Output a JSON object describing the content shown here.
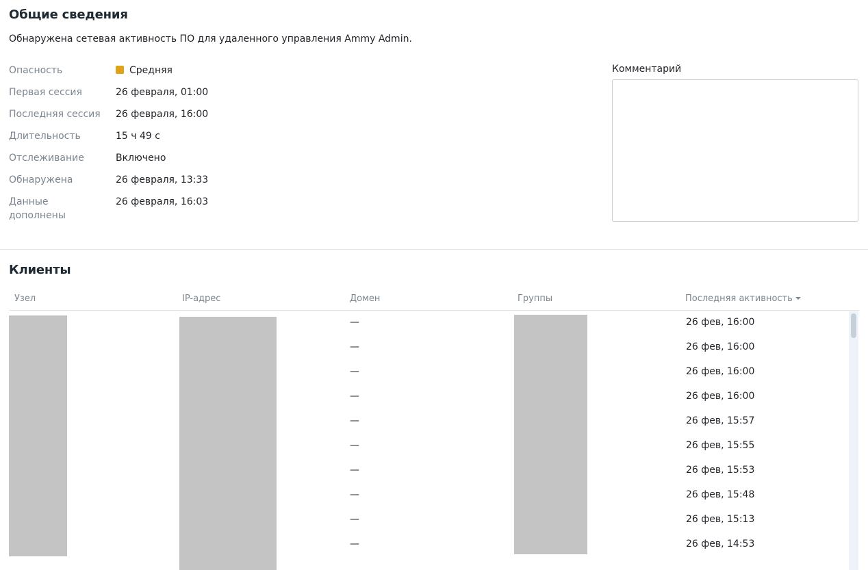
{
  "overview": {
    "title": "Общие сведения",
    "description": "Обнаружена сетевая активность ПО для удаленного управления Ammy Admin.",
    "severity_color": "#e0a21b",
    "properties": [
      {
        "label": "Опасность",
        "value": "Средняя"
      },
      {
        "label": "Первая сессия",
        "value": "26 февраля, 01:00"
      },
      {
        "label": "Последняя сессия",
        "value": "26 февраля, 16:00"
      },
      {
        "label": "Длительность",
        "value": "15 ч 49 с"
      },
      {
        "label": "Отслеживание",
        "value": "Включено"
      },
      {
        "label": "Обнаружена",
        "value": "26 февраля, 13:33"
      },
      {
        "label": "Данные\nдополнены",
        "value": "26 февраля, 16:03"
      }
    ],
    "comment_label": "Комментарий",
    "comment_value": ""
  },
  "clients": {
    "title": "Клиенты",
    "columns": [
      "Узел",
      "IP-адрес",
      "Домен",
      "Группы",
      "Последняя активность"
    ],
    "rows": [
      {
        "domain": "—",
        "last": "26 фев, 16:00"
      },
      {
        "domain": "—",
        "last": "26 фев, 16:00"
      },
      {
        "domain": "—",
        "last": "26 фев, 16:00"
      },
      {
        "domain": "—",
        "last": "26 фев, 16:00"
      },
      {
        "domain": "—",
        "last": "26 фев, 15:57"
      },
      {
        "domain": "—",
        "last": "26 фев, 15:55"
      },
      {
        "domain": "—",
        "last": "26 фев, 15:53"
      },
      {
        "domain": "—",
        "last": "26 фев, 15:48"
      },
      {
        "domain": "—",
        "last": "26 фев, 15:13"
      },
      {
        "domain": "—",
        "last": "26 фев, 14:53"
      }
    ],
    "sort_icon": "caret-down-icon"
  }
}
